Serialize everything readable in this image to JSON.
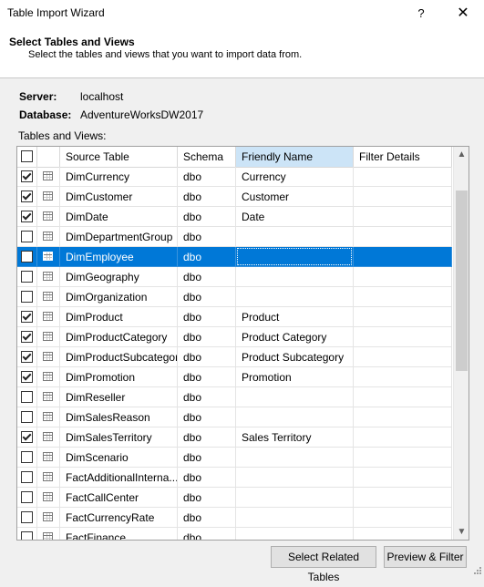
{
  "window": {
    "title": "Table Import Wizard",
    "help_label": "?",
    "close_label": "✕"
  },
  "header": {
    "title": "Select Tables and Views",
    "subtitle": "Select the tables and views that you want to import data from."
  },
  "info": {
    "server_label": "Server:",
    "server_value": "localhost",
    "database_label": "Database:",
    "database_value": "AdventureWorksDW2017"
  },
  "grid": {
    "label": "Tables and Views:",
    "header_all_checked": false,
    "columns": [
      "Source Table",
      "Schema",
      "Friendly Name",
      "Filter Details"
    ],
    "active_column": "Friendly Name",
    "rows": [
      {
        "checked": true,
        "source": "DimCurrency",
        "schema": "dbo",
        "friendly": "Currency",
        "filter": ""
      },
      {
        "checked": true,
        "source": "DimCustomer",
        "schema": "dbo",
        "friendly": "Customer",
        "filter": ""
      },
      {
        "checked": true,
        "source": "DimDate",
        "schema": "dbo",
        "friendly": "Date",
        "filter": ""
      },
      {
        "checked": false,
        "source": "DimDepartmentGroup",
        "schema": "dbo",
        "friendly": "",
        "filter": ""
      },
      {
        "checked": false,
        "source": "DimEmployee",
        "schema": "dbo",
        "friendly": "",
        "filter": "",
        "selected": true
      },
      {
        "checked": false,
        "source": "DimGeography",
        "schema": "dbo",
        "friendly": "",
        "filter": ""
      },
      {
        "checked": false,
        "source": "DimOrganization",
        "schema": "dbo",
        "friendly": "",
        "filter": ""
      },
      {
        "checked": true,
        "source": "DimProduct",
        "schema": "dbo",
        "friendly": "Product",
        "filter": ""
      },
      {
        "checked": true,
        "source": "DimProductCategory",
        "schema": "dbo",
        "friendly": "Product Category",
        "filter": ""
      },
      {
        "checked": true,
        "source": "DimProductSubcategory",
        "schema": "dbo",
        "friendly": "Product Subcategory",
        "filter": ""
      },
      {
        "checked": true,
        "source": "DimPromotion",
        "schema": "dbo",
        "friendly": "Promotion",
        "filter": ""
      },
      {
        "checked": false,
        "source": "DimReseller",
        "schema": "dbo",
        "friendly": "",
        "filter": ""
      },
      {
        "checked": false,
        "source": "DimSalesReason",
        "schema": "dbo",
        "friendly": "",
        "filter": ""
      },
      {
        "checked": true,
        "source": "DimSalesTerritory",
        "schema": "dbo",
        "friendly": "Sales Territory",
        "filter": ""
      },
      {
        "checked": false,
        "source": "DimScenario",
        "schema": "dbo",
        "friendly": "",
        "filter": ""
      },
      {
        "checked": false,
        "source": "FactAdditionalInterna...",
        "schema": "dbo",
        "friendly": "",
        "filter": ""
      },
      {
        "checked": false,
        "source": "FactCallCenter",
        "schema": "dbo",
        "friendly": "",
        "filter": ""
      },
      {
        "checked": false,
        "source": "FactCurrencyRate",
        "schema": "dbo",
        "friendly": "",
        "filter": ""
      },
      {
        "checked": false,
        "source": "FactFinance",
        "schema": "dbo",
        "friendly": "",
        "filter": ""
      }
    ]
  },
  "scrollbar": {
    "up_icon": "chevron-up-icon",
    "down_icon": "chevron-down-icon",
    "up_glyph": "▲",
    "down_glyph": "▼"
  },
  "buttons": {
    "select_related": "Select Related Tables",
    "preview_filter": "Preview & Filter"
  },
  "colors": {
    "selection": "#0078d7",
    "active_header": "#cce4f7"
  }
}
